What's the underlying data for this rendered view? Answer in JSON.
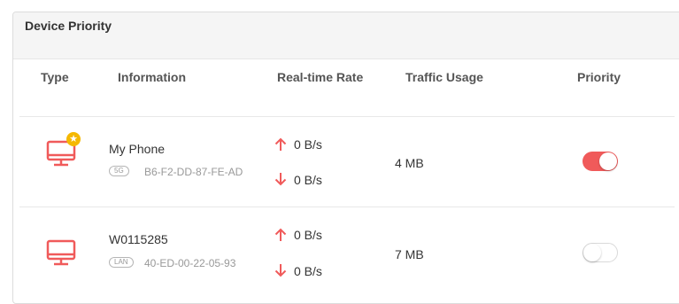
{
  "panel": {
    "title": "Device Priority"
  },
  "table": {
    "headers": {
      "type": "Type",
      "information": "Information",
      "rate": "Real-time Rate",
      "traffic": "Traffic Usage",
      "priority": "Priority"
    },
    "rows": [
      {
        "icon": "monitor-icon",
        "starred": true,
        "name": "My Phone",
        "band": "5G",
        "mac": "B6-F2-DD-87-FE-AD",
        "upload_rate": "0 B/s",
        "download_rate": "0 B/s",
        "traffic": "4 MB",
        "priority": true
      },
      {
        "icon": "monitor-icon",
        "starred": false,
        "name": "W0115285",
        "band": "LAN",
        "mac": "40-ED-00-22-05-93",
        "upload_rate": "0 B/s",
        "download_rate": "0 B/s",
        "traffic": "7 MB",
        "priority": false
      }
    ]
  },
  "colors": {
    "accent": "#f05a5a",
    "star": "#f5b800",
    "header_bg": "#f5f5f5"
  }
}
